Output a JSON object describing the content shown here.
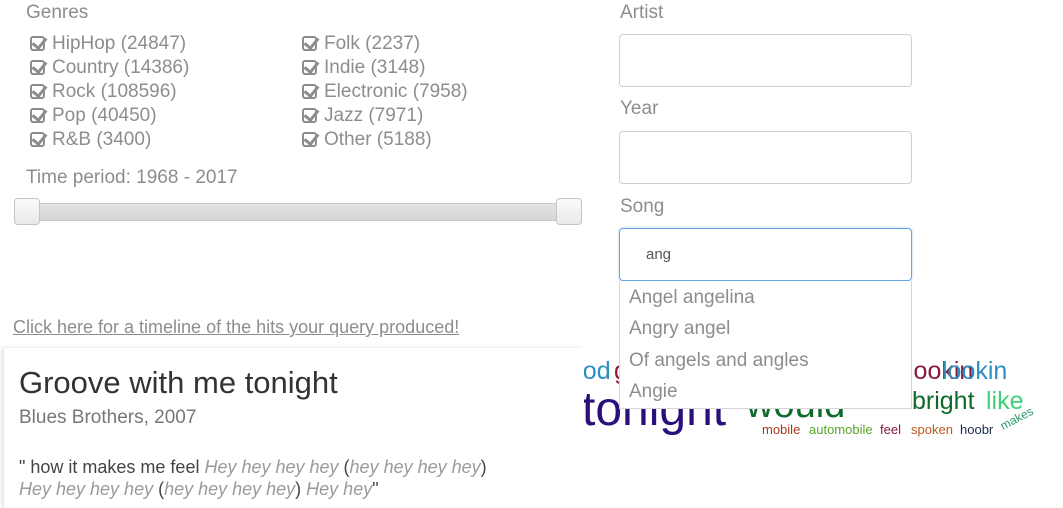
{
  "filters": {
    "genres_label": "Genres",
    "genres": [
      {
        "label": "HipHop (24847)",
        "checked": true
      },
      {
        "label": "Country (14386)",
        "checked": true
      },
      {
        "label": "Rock (108596)",
        "checked": true
      },
      {
        "label": "Pop (40450)",
        "checked": true
      },
      {
        "label": "R&B (3400)",
        "checked": true
      },
      {
        "label": "Folk (2237)",
        "checked": true
      },
      {
        "label": "Indie (3148)",
        "checked": true
      },
      {
        "label": "Electronic (7958)",
        "checked": true
      },
      {
        "label": "Jazz (7971)",
        "checked": true
      },
      {
        "label": "Other (5188)",
        "checked": true
      }
    ],
    "time_period_label": "Time period: 1968 - 2017",
    "time_range": {
      "min": 1968,
      "max": 2017
    }
  },
  "search": {
    "artist_label": "Artist",
    "artist_value": "",
    "year_label": "Year",
    "year_value": "",
    "song_label": "Song",
    "song_value": "ang",
    "suggestions": [
      "Angel angelina",
      "Angry angel",
      "Of angels and angles",
      "Angie"
    ]
  },
  "timeline_link": "Click here for a timeline of the hits your query produced!",
  "result": {
    "title": "Groove with me tonight",
    "subtitle": "Blues Brothers, 2007",
    "lyrics": {
      "l1a": "\" how it makes me feel ",
      "l1b": "Hey hey hey hey",
      "l1c": " (",
      "l1d": "hey hey hey hey",
      "l1e": ")",
      "l2a": "Hey hey hey hey",
      "l2b": " (",
      "l2c": "hey hey hey hey",
      "l2d": ") ",
      "l2e": "Hey hey",
      "l2f": "\""
    }
  },
  "word_cloud": {
    "words": [
      {
        "text": "good",
        "color": "#2a8fc1"
      },
      {
        "text": "g",
        "color": "#8b1a3a"
      },
      {
        "text": "lookin",
        "color": "#2a8fc1"
      },
      {
        "text": "tonight",
        "color": "#2b0f7a"
      },
      {
        "text": "would",
        "color": "#0f6b2a"
      },
      {
        "text": "bright",
        "color": "#0f6b2a"
      },
      {
        "text": "like",
        "color": "#3fd17a"
      },
      {
        "text": "mobile",
        "color": "#a83a1a"
      },
      {
        "text": "automobile",
        "color": "#5aa52a"
      },
      {
        "text": "feel",
        "color": "#8b1a3a"
      },
      {
        "text": "spoken",
        "color": "#c05a1a"
      },
      {
        "text": "hoobr",
        "color": "#1a2a4a"
      },
      {
        "text": "makes",
        "color": "#2a9a6a"
      }
    ]
  }
}
